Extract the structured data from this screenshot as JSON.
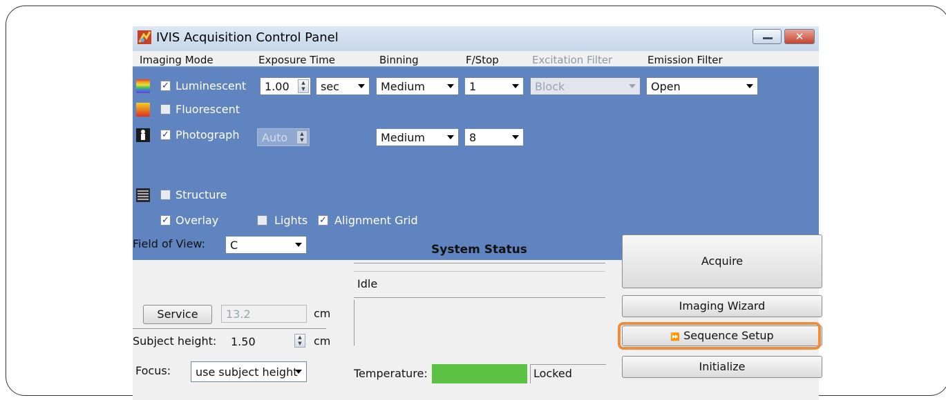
{
  "window": {
    "title": "IVIS Acquisition Control Panel",
    "close_glyph": "✕"
  },
  "columns": {
    "imaging_mode": "Imaging Mode",
    "exposure_time": "Exposure Time",
    "binning": "Binning",
    "fstop": "F/Stop",
    "excitation_filter": "Excitation Filter",
    "emission_filter": "Emission Filter"
  },
  "modes": {
    "luminescent": {
      "label": "Luminescent",
      "checked": true,
      "exposure": "1.00",
      "unit": "sec",
      "binning": "Medium",
      "fstop": "1",
      "excitation": "Block",
      "emission": "Open"
    },
    "fluorescent": {
      "label": "Fluorescent",
      "checked": false
    },
    "photograph": {
      "label": "Photograph",
      "checked": true,
      "exposure": "Auto",
      "binning": "Medium",
      "fstop": "8"
    },
    "structure": {
      "label": "Structure",
      "checked": false
    }
  },
  "options": {
    "overlay": {
      "label": "Overlay",
      "checked": true
    },
    "lights": {
      "label": "Lights",
      "checked": false
    },
    "alignment_grid": {
      "label": "Alignment Grid",
      "checked": true
    }
  },
  "check_glyph": "✓",
  "field_of_view": {
    "label": "Field of View:",
    "value": "C"
  },
  "service": {
    "button": "Service",
    "value": "13.2",
    "unit": "cm"
  },
  "subject_height": {
    "label": "Subject height:",
    "value": "1.50",
    "unit": "cm"
  },
  "focus": {
    "label": "Focus:",
    "value": "use subject height"
  },
  "system_status": {
    "title": "System Status",
    "status": "Idle",
    "temperature_label": "Temperature:",
    "temperature_state": "Locked",
    "temperature_color": "#5cc244"
  },
  "buttons": {
    "acquire": "Acquire",
    "imaging_wizard": "Imaging Wizard",
    "sequence_setup": "Sequence Setup",
    "sequence_glyph": "⏩",
    "initialize": "Initialize"
  },
  "colors": {
    "panel_blue": "#5f84c0",
    "highlight_orange": "#ee8c3c"
  }
}
